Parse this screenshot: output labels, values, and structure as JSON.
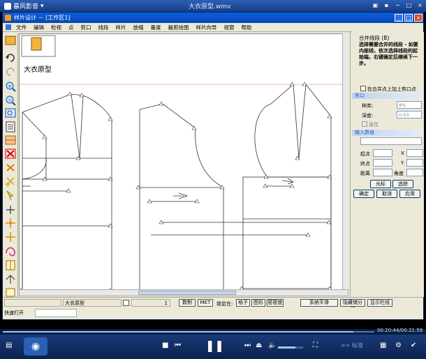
{
  "player": {
    "brand": "暴风影音",
    "filename": "大衣原型.wmv",
    "time": "00:20:44/00:21:59",
    "progress_fraction": 0.943,
    "standard_label": "标准",
    "volume_fraction": 0.7
  },
  "app": {
    "title": "样片设计 － [工作区1]",
    "menu": [
      "文件",
      "编辑",
      "检视",
      "点",
      "剪口",
      "线段",
      "样片",
      "放缩",
      "量度",
      "裁剪绘图",
      "样片向导",
      "视窗",
      "帮助"
    ]
  },
  "canvas": {
    "piece_name": "大衣原型"
  },
  "right_panel": {
    "header": "合并线段 (B)",
    "description": "选择需要合并的线段 - 如要内部线，依次选择线段的起始端，右键确定后继续下一步。",
    "checkbox_label": "在合并点上加上剪口点",
    "notch_section": "剪口",
    "type_label": "种类:",
    "type_value": "8%",
    "depth_label": "深度:",
    "depth_value": "0.63",
    "attr_label": "属性",
    "input_section": "输入数值",
    "start_label": "起点",
    "end_label": "终点",
    "distance_label": "距离",
    "x_label": "X",
    "y_label": "Y",
    "angle_label": "角度",
    "cursor_btn": "光标",
    "track_btn": "追踪",
    "ok_btn": "确定",
    "cancel_btn": "取消",
    "apply_btn": "应用"
  },
  "statusbar": {
    "piece": "大衣原型",
    "number": "1",
    "draft_btn": "数制",
    "met_btn": "MET",
    "lock_label": "锁定在:",
    "grid_btn": "格子",
    "shape_btn": "图形",
    "density_btn": "密密度",
    "system_btn": "系统平滑",
    "follow_btn": "隐藏储分线",
    "show_btn": "显示栏线",
    "quick_open": "快速打开"
  }
}
